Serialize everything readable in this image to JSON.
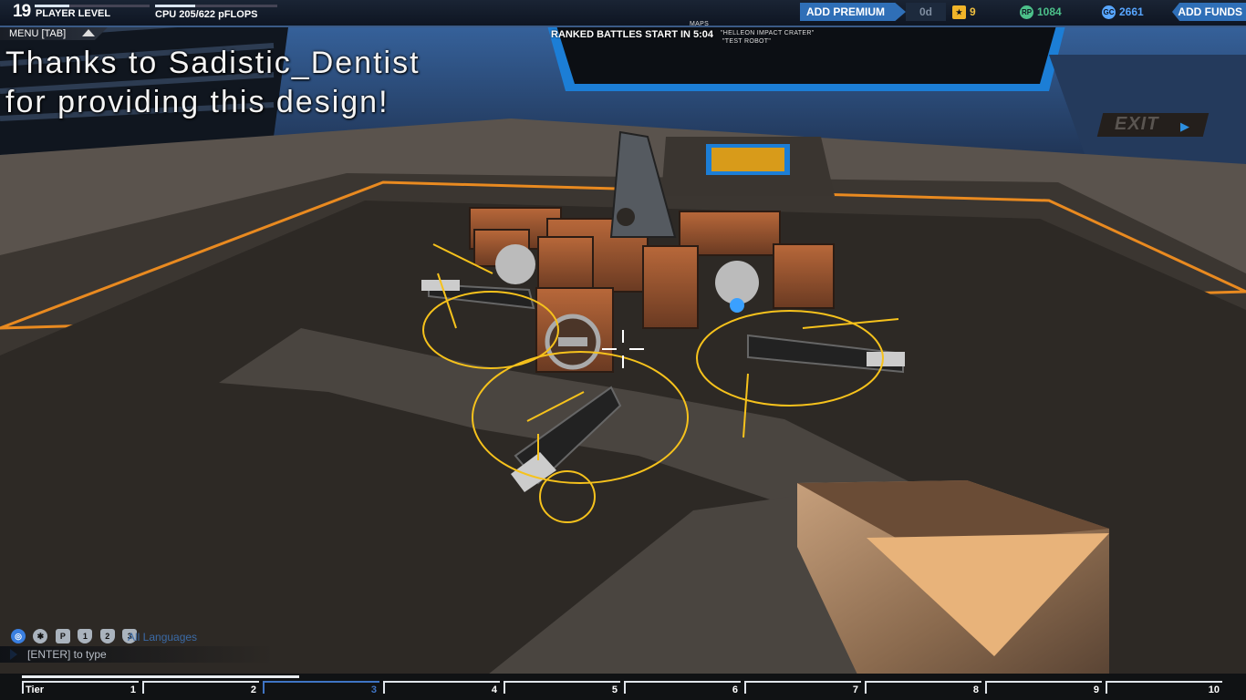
{
  "topbar": {
    "player_level": "19",
    "player_level_label": "PLAYER LEVEL",
    "level_progress": 0.3,
    "cpu_label": "CPU 205/622 pFLOPS",
    "cpu_progress": 0.33,
    "add_premium_label": "ADD PREMIUM",
    "premium_days": "0d",
    "stars": "9",
    "robot_points": "1084",
    "galaxy_credits": "2661",
    "add_funds_label": "ADD FUNDS",
    "colors": {
      "accent": "#2f6fb7",
      "stars": "#f0c040",
      "rp": "#4cc08a",
      "gc": "#58a6ff"
    }
  },
  "menu": {
    "label": "MENU [TAB]"
  },
  "overlay": {
    "message": "Thanks to Sadistic_Dentist\nfor providing this design!"
  },
  "banner": {
    "ranked": "RANKED BATTLES START IN 5:04",
    "map_label": "MAPS",
    "map_value": "\"HELLEON IMPACT CRATER\"",
    "robot_value": "\"TEST ROBOT\""
  },
  "exit": {
    "label": "EXIT"
  },
  "chat": {
    "language": "All Languages",
    "input_placeholder": "[ENTER] to type",
    "icons": [
      "globe-icon",
      "accessibility-icon",
      "p-icon",
      "party-1-icon",
      "party-2-icon",
      "party-3-icon"
    ]
  },
  "tiers": {
    "label": "Tier",
    "current": "3",
    "progress": 0.23,
    "numbers": [
      "1",
      "2",
      "3",
      "4",
      "5",
      "6",
      "7",
      "8",
      "9",
      "10"
    ]
  }
}
